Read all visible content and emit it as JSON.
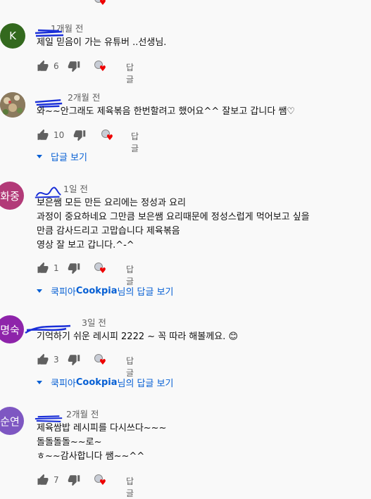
{
  "top_remnant": {
    "heart": "♥"
  },
  "comments": [
    {
      "avatar_text": "K",
      "avatar_color": "#33691e",
      "name": "",
      "time": "1개월 전",
      "text": "제일 믿음이 가는 유튜버 ..선생님.",
      "likes": "6",
      "reply_label": "답글"
    },
    {
      "avatar_text": "",
      "avatar_color": "#7a6a55",
      "name": "",
      "time": "2개월 전",
      "text": "와~~안그래도 제육볶음 한번할려고 했어요^^ 잘보고 갑니다 쌤♡",
      "likes": "10",
      "reply_label": "답글",
      "replies_link": "답글 보기"
    },
    {
      "avatar_text": "화중",
      "avatar_color": "#b23a78",
      "name": "",
      "time": "1일 전",
      "text": "보은쌤 모든 만든 요리에는 정성과 요리\n과정이 중요하네요 그만큼 보은쌤 요리때문에 정성스럽게 먹어보고 싶을\n만큼 감사드리고 고맙습니다 제육볶음\n영상 잘 보고 갑니다.^-^",
      "likes": "1",
      "reply_label": "답글",
      "replies_link_prefix": "쿡피아 ",
      "replies_link_bold": "Cookpia",
      "replies_link_suffix": "님의 답글 보기"
    },
    {
      "avatar_text": "명숙",
      "avatar_color": "#8e24aa",
      "name": "",
      "time": "3일 전",
      "text": "기억하기 쉬운 레시피 2222 ~ 꼭 따라 해볼께요. 😊",
      "likes": "3",
      "reply_label": "답글",
      "replies_link_prefix": "쿡피아 ",
      "replies_link_bold": "Cookpia",
      "replies_link_suffix": "님의 답글 보기"
    },
    {
      "avatar_text": "순연",
      "avatar_color": "#7e57c2",
      "name": "",
      "time": "2개월 전",
      "text": "제육쌈밥  레시피를 다시쓰다~~~\n돌돌돌돌~~로~\nㅎ~~감사합니다 쌤~~^^",
      "likes": "7",
      "reply_label": "답글"
    }
  ]
}
